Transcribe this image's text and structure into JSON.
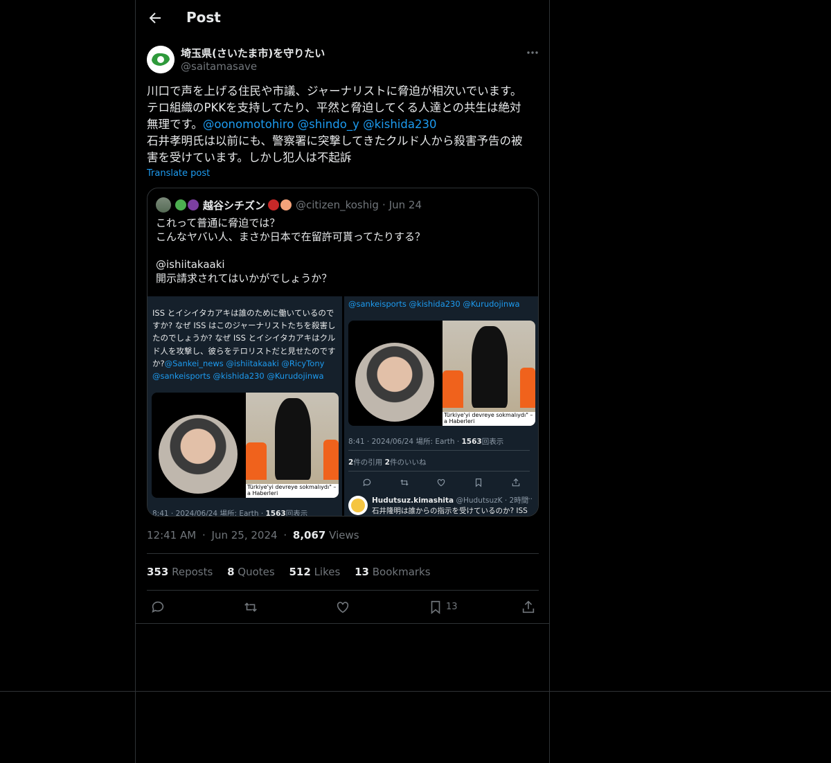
{
  "header": {
    "title": "Post"
  },
  "author": {
    "name": "埼玉県(さいたま市)を守りたい",
    "handle": "@saitamasave"
  },
  "post": {
    "line1": "川口で声を上げる住民や市議、ジャーナリストに脅迫が相次いでいます。",
    "line2": "テロ組織のPKKを支持してたり、平然と脅迫してくる人達との共生は絶対",
    "line3_prefix": "無理です。",
    "mention1": "@oonomotohiro",
    "mention2": "@shindo_y",
    "mention3": "@kishida230",
    "line4": "石井孝明氏は以前にも、警察署に突撃してきたクルド人から殺害予告の被",
    "line5": "害を受けています。しかし犯人は不起訴",
    "translate": "Translate post"
  },
  "quote": {
    "name": "越谷シチズン",
    "handle": "@citizen_koshig",
    "sep": "·",
    "date": "Jun 24",
    "text": "これって普通に脅迫では？\nこんなヤバい人、まさか日本で在留許可貰ってたりする？\n\n@ishiitakaaki\n開示請求されてはいかがでしょうか？",
    "media": {
      "left_text": "ISS とイシイタカアキは誰のために働いているのですか? なぜ ISS はこのジャーナリストたちを殺害したのでしょうか? なぜ ISS とイシイタカアキはクルド人を攻撃し、彼らをテロリストだと見せたのですか?",
      "left_mentions": "@Sankei_news @ishiitakaaki @RicyTony @sankeisports @kishida230 @Kurudojinwa",
      "left_caption": "Türkiye'yi devreye sokmalıydı\" –\na Haberleri",
      "left_footer": "8:41 · 2024/06/24 場所: Earth · ",
      "left_footer_views": "1563",
      "left_footer_views_label": "回表示",
      "right_mentions": "@sankeisports @kishida230 @Kurudojinwa",
      "right_caption": "Türkiye'yi devreye sokmalıydı\" –\na Haberleri",
      "right_footer": "8:41 · 2024/06/24 場所: Earth · ",
      "right_footer_views": "1563",
      "right_footer_views_label": "回表示",
      "quotes_count": "2",
      "quotes_label": "件の引用",
      "likes_count": "2",
      "likes_label": "件のいいね",
      "reply_name": "Hudutsuz.kimashita",
      "reply_handle": "@HudutsuzK · 2時間",
      "reply_more": "···",
      "reply_text": "石井隆明は誰からの指示を受けているのか? ISS"
    }
  },
  "meta": {
    "time": "12:41 AM",
    "sep1": "·",
    "date": "Jun 25, 2024",
    "sep2": "·",
    "views": "8,067",
    "views_label": "Views"
  },
  "stats": {
    "reposts": "353",
    "reposts_label": "Reposts",
    "quotes": "8",
    "quotes_label": "Quotes",
    "likes": "512",
    "likes_label": "Likes",
    "bookmarks": "13",
    "bookmarks_label": "Bookmarks"
  },
  "actions": {
    "bookmark_count": "13"
  },
  "colors": {
    "accent": "#1d9bf0",
    "muted": "#71767b",
    "border": "#2f3336"
  }
}
